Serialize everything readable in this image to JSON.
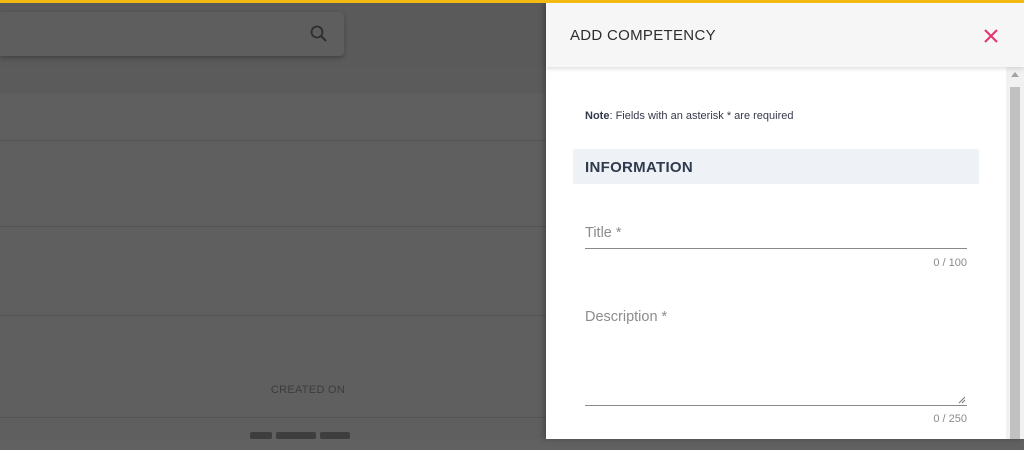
{
  "drawer": {
    "title": "ADD COMPETENCY",
    "note_bold": "Note",
    "note_text": ": Fields with an asterisk * are required",
    "section_title": "INFORMATION",
    "fields": [
      {
        "label": "Title *",
        "value": "",
        "counter": "0 / 100"
      },
      {
        "label": "Description *",
        "value": "",
        "counter": "0 / 250"
      }
    ]
  },
  "background": {
    "table_header": "CREATED ON"
  },
  "colors": {
    "accent": "#f5b914",
    "close": "#e5336b",
    "overlay": "#616161",
    "section_bg": "#eef1f5"
  },
  "icons": {
    "search": "search-icon",
    "close": "close-icon"
  }
}
